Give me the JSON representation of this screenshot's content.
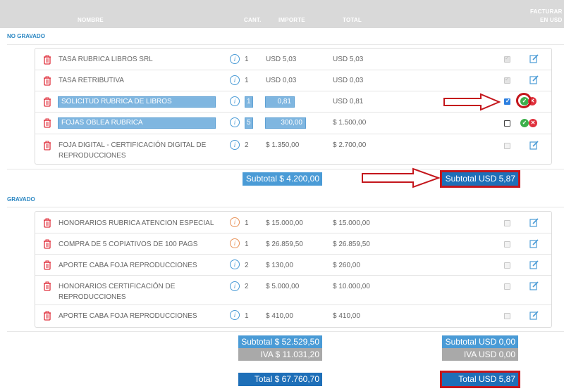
{
  "header": {
    "nombre": "NOMBRE",
    "cant": "CANT.",
    "importe": "IMPORTE",
    "total": "TOTAL",
    "facturar": "FACTURAR",
    "en_usd": "EN USD"
  },
  "sections": {
    "no_gravado": "NO GRAVADO",
    "gravado": "GRAVADO"
  },
  "no_gravado_rows": [
    {
      "name": "TASA RUBRICA LIBROS SRL",
      "qty": "1",
      "importe": "USD 5,03",
      "total": "USD 5,03"
    },
    {
      "name": "TASA RETRIBUTIVA",
      "qty": "1",
      "importe": "USD 0,03",
      "total": "USD 0,03"
    },
    {
      "name": "SOLICITUD RUBRICA DE LIBROS",
      "qty": "1",
      "importe": "0,81",
      "total": "USD 0,81"
    },
    {
      "name": "FOJAS OBLEA RUBRICA",
      "qty": "5",
      "importe": "300,00",
      "total": "$ 1.500,00"
    },
    {
      "name_line1": "FOJA DIGITAL - CERTIFICACIÓN DIGITAL DE",
      "name_line2": "REPRODUCCIONES",
      "qty": "2",
      "importe": "$ 1.350,00",
      "total": "$ 2.700,00"
    }
  ],
  "gravado_rows": [
    {
      "name": "HONORARIOS RUBRICA ATENCION ESPECIAL",
      "qty": "1",
      "importe": "$ 15.000,00",
      "total": "$ 15.000,00"
    },
    {
      "name": "COMPRA DE 5 COPIATIVOS DE 100 PAGS",
      "qty": "1",
      "importe": "$ 26.859,50",
      "total": "$ 26.859,50"
    },
    {
      "name": "APORTE CABA FOJA REPRODUCCIONES",
      "qty": "2",
      "importe": "$ 130,00",
      "total": "$ 260,00"
    },
    {
      "name_line1": "HONORARIOS CERTIFICACIÓN DE",
      "name_line2": "REPRODUCCIONES",
      "qty": "2",
      "importe": "$ 5.000,00",
      "total": "$ 10.000,00"
    },
    {
      "name": "APORTE CABA FOJA REPRODUCCIONES",
      "qty": "1",
      "importe": "$ 410,00",
      "total": "$ 410,00"
    }
  ],
  "totals": {
    "ng_subtotal_ars": "Subtotal  $ 4.200,00",
    "ng_subtotal_usd": "Subtotal  USD 5,87",
    "g_subtotal_ars": "Subtotal  $ 52.529,50",
    "g_iva_ars": "IVA  $ 11.031,20",
    "g_subtotal_usd": "Subtotal  USD 0,00",
    "g_iva_usd": "IVA  USD 0,00",
    "total_ars": "Total  $ 67.760,70",
    "total_usd": "Total  USD 5,87"
  },
  "icons": {
    "trash": "trash-icon",
    "info": "info-icon",
    "edit": "edit-icon",
    "accept": "check-circle-icon",
    "cancel": "x-circle-icon"
  },
  "colors": {
    "accent_blue": "#4a9bd6",
    "dark_blue": "#1e6fb8",
    "annotation_red": "#c4161c",
    "delete_red": "#e0313d",
    "confirm_green": "#3db04c"
  }
}
